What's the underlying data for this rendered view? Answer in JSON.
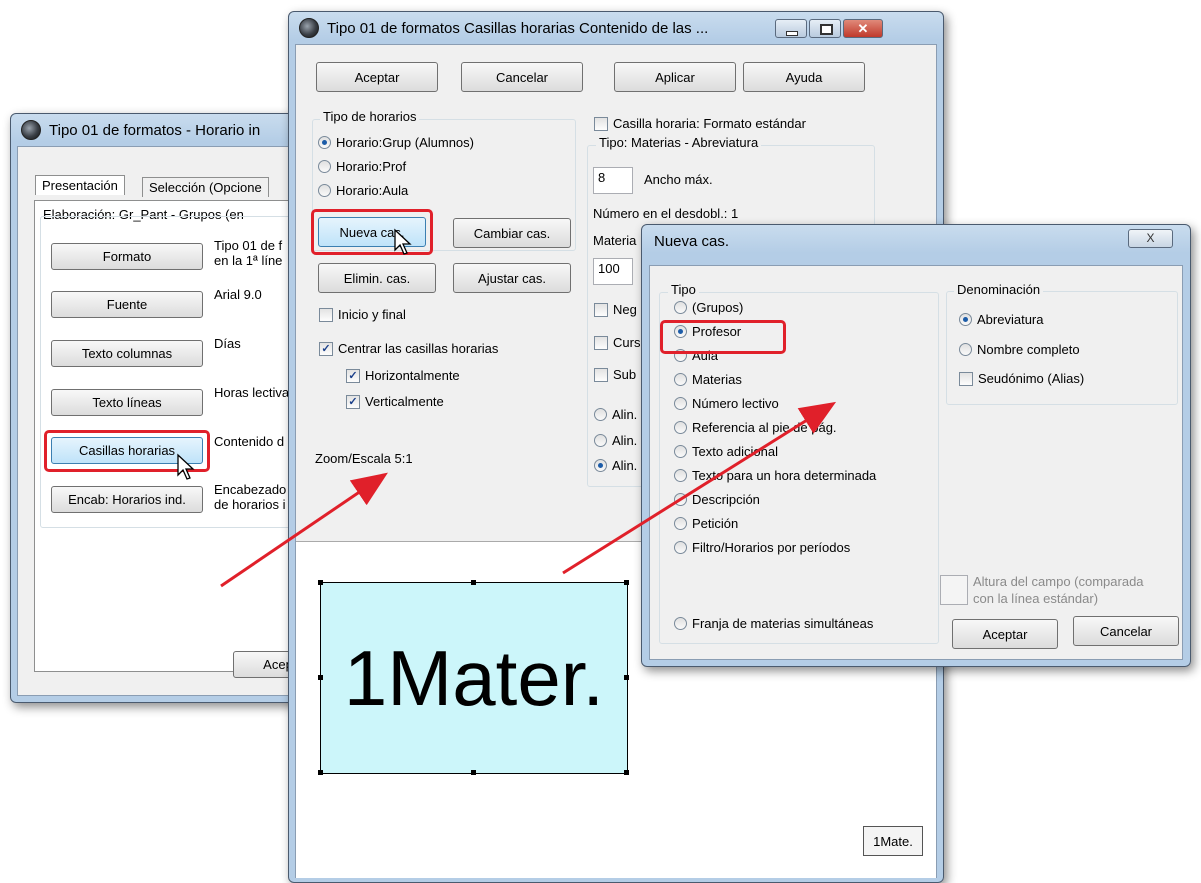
{
  "win1": {
    "title": "Tipo 01 de formatos - Horario in",
    "tabs": [
      "Presentación",
      "Selección (Opcione"
    ],
    "elaboracion": "Elaboración: Gr_Pant - Grupos (en",
    "rows": [
      {
        "button": "Formato",
        "desc1": "Tipo 01 de f",
        "desc2": "en la 1ª líne"
      },
      {
        "button": "Fuente",
        "desc1": "Arial 9.0",
        "desc2": ""
      },
      {
        "button": "Texto columnas",
        "desc1": "Días",
        "desc2": ""
      },
      {
        "button": "Texto líneas",
        "desc1": "Horas lectiva",
        "desc2": ""
      },
      {
        "button": "Casillas horarias",
        "desc1": "Contenido d",
        "desc2": ""
      },
      {
        "button": "Encab: Horarios ind.",
        "desc1": "Encabezado",
        "desc2": "de horarios i"
      }
    ],
    "accept": "Acep"
  },
  "win2": {
    "title": "Tipo 01 de formatos  Casillas horarias  Contenido de las ...",
    "buttons": {
      "aceptar": "Aceptar",
      "cancelar": "Cancelar",
      "aplicar": "Aplicar",
      "ayuda": "Ayuda"
    },
    "tipo_horarios": {
      "title": "Tipo de horarios",
      "options": [
        "Horario:Grup (Alumnos)",
        "Horario:Prof",
        "Horario:Aula"
      ],
      "selected_index": 0
    },
    "cell_buttons": {
      "nueva": "Nueva cas.",
      "cambiar": "Cambiar cas.",
      "elimin": "Elimin. cas.",
      "ajustar": "Ajustar cas."
    },
    "inicio_final": "Inicio y final",
    "centrar": "Centrar las casillas horarias",
    "horizontal": "Horizontalmente",
    "vertical": "Verticalmente",
    "zoom": "Zoom/Escala  5:1",
    "formato_estandar": "Casilla horaria: Formato estándar",
    "tipo_materias": "Tipo: Materias - Abreviatura",
    "ancho_value": "8",
    "ancho_label": "Ancho máx.",
    "numero_desdobl": "Número en el desdobl.: 1",
    "materia_partial": "Materia",
    "size_value": "100",
    "partial_checks": [
      "Neg",
      "Curs",
      "Sub"
    ],
    "partial_align": [
      "Alin.",
      "Alin.",
      "Alin."
    ],
    "preview_big": "1Mater.",
    "preview_small": "1Mate."
  },
  "win3": {
    "title": "Nueva cas.",
    "close_label": "X",
    "tipo_title": "Tipo",
    "tipo_options": [
      "(Grupos)",
      "Profesor",
      "Aula",
      "Materias",
      "Número lectivo",
      "Referencia al pie de pág.",
      "Texto adicional",
      "Texto para un hora determinada",
      "Descripción",
      "Petición",
      "Filtro/Horarios por períodos"
    ],
    "tipo_selected_index": 1,
    "franja": "Franja de materias simultáneas",
    "denominacion_title": "Denominación",
    "denominacion_options": [
      "Abreviatura",
      "Nombre completo"
    ],
    "denominacion_selected_index": 0,
    "seudonimo": "Seudónimo (Alias)",
    "altura_line1": "Altura del campo (comparada",
    "altura_line2": "con la línea estándar)",
    "aceptar": "Aceptar",
    "cancelar": "Cancelar"
  },
  "colors": {
    "highlight": "#e0202a",
    "preview_bg": "#ccf6fa",
    "arrow": "#e0202a"
  }
}
